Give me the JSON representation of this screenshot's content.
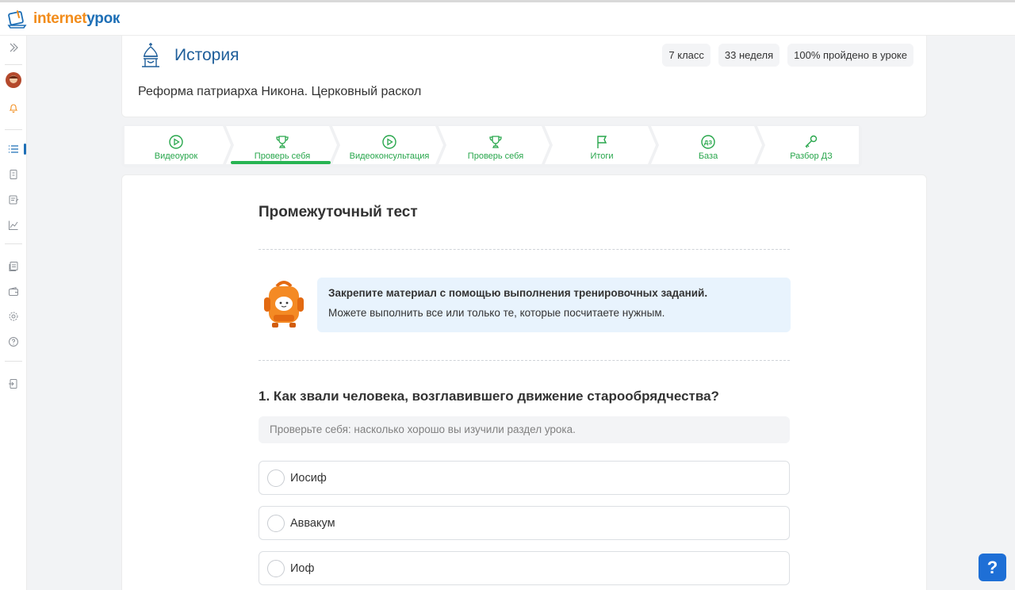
{
  "brand": {
    "part1": "internet",
    "part2": "урок"
  },
  "subject": {
    "title": "История",
    "tags": [
      "7 класс",
      "33 неделя",
      "100% пройдено в уроке"
    ],
    "lesson_title": "Реформа патриарха Никона. Церковный раскол"
  },
  "tabs": [
    {
      "label": "Видеоурок",
      "icon": "play-circle-icon"
    },
    {
      "label": "Проверь себя",
      "icon": "trophy-icon",
      "active": true
    },
    {
      "label": "Видеоконсультация",
      "icon": "play-circle-icon"
    },
    {
      "label": "Проверь себя",
      "icon": "trophy-icon"
    },
    {
      "label": "Итоги",
      "icon": "flag-icon"
    },
    {
      "label": "База",
      "icon": "dz-badge-icon",
      "icon_text": "ДЗ"
    },
    {
      "label": "Разбор ДЗ",
      "icon": "key-icon"
    }
  ],
  "test": {
    "title": "Промежуточный тест",
    "info_line1": "Закрепите материал с помощью выполнения тренировочных заданий.",
    "info_line2": "Можете выполнить все или только те, которые посчитаете нужным.",
    "question": "1. Как звали человека, возглавившего движение старообрядчества?",
    "hint": "Проверьте себя: насколько хорошо вы изучили раздел урока.",
    "options": [
      "Иосиф",
      "Аввакум",
      "Иоф"
    ]
  },
  "help": {
    "label": "?"
  },
  "colors": {
    "accent_green": "#27b452",
    "brand_blue": "#1e6fb6",
    "brand_orange": "#f28c1b"
  }
}
